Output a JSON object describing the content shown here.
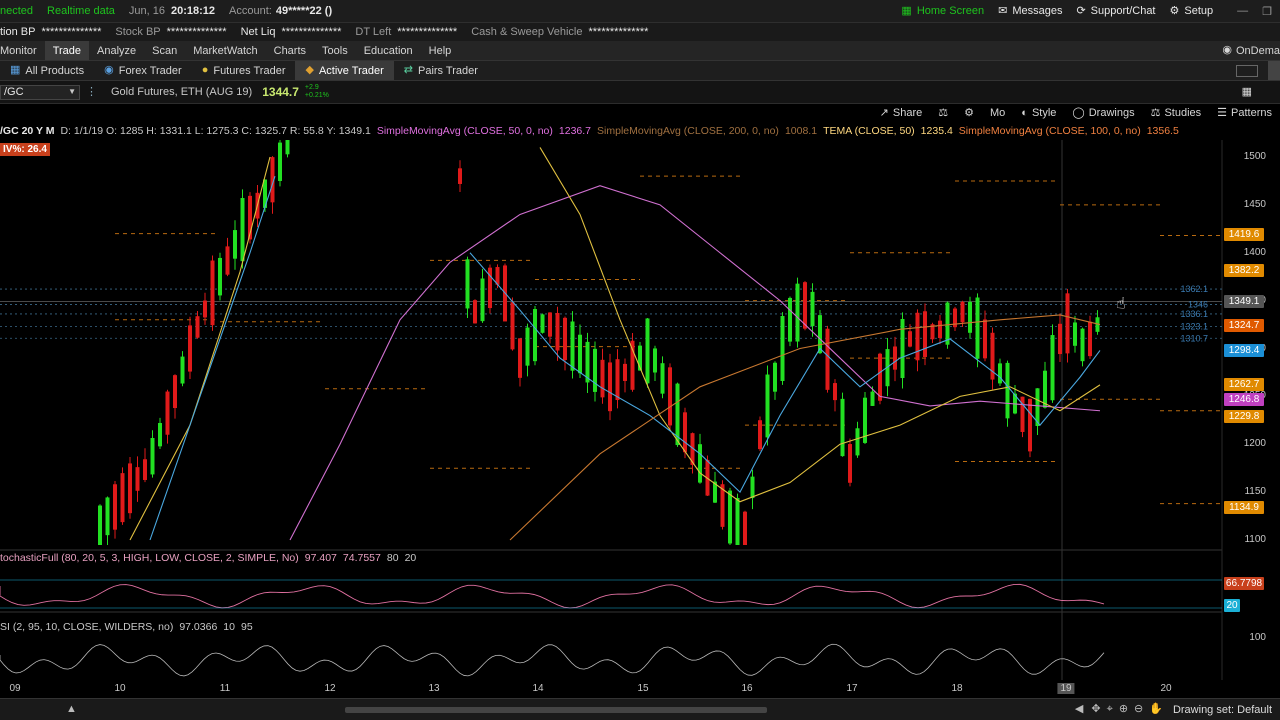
{
  "status": {
    "connection": "nected",
    "realtime": "Realtime data",
    "date": "Jun, 16",
    "time": "20:18:12",
    "account_label": "Account:",
    "account_value": "49*****22 ()",
    "home_screen": "Home Screen",
    "messages": "Messages",
    "support": "Support/Chat",
    "setup": "Setup"
  },
  "account_bar": {
    "option_bp_label": "tion BP",
    "option_bp_value": "**************",
    "stock_bp_label": "Stock BP",
    "stock_bp_value": "**************",
    "net_liq_label": "Net Liq",
    "net_liq_value": "**************",
    "dt_left_label": "DT Left",
    "dt_left_value": "**************",
    "cash_label": "Cash & Sweep Vehicle",
    "cash_value": "**************"
  },
  "menu": {
    "items": [
      "Monitor",
      "Trade",
      "Analyze",
      "Scan",
      "MarketWatch",
      "Charts",
      "Tools",
      "Education",
      "Help"
    ],
    "right": "OnDema"
  },
  "tabs": {
    "items": [
      "All Products",
      "Forex Trader",
      "Futures Trader",
      "Active Trader",
      "Pairs Trader"
    ]
  },
  "symbol": {
    "ticker": "/GC",
    "description": "Gold Futures, ETH (AUG 19)",
    "last": "1344.7",
    "change_top": "+2.9",
    "change_bottom": "+0.21%"
  },
  "chart_toolbar": {
    "share": "Share",
    "mode": "Mo",
    "style": "Style",
    "drawings": "Drawings",
    "studies": "Studies",
    "patterns": "Patterns"
  },
  "study_bar": {
    "period": "/GC 20 Y M",
    "ohlc": "D: 1/1/19   O: 1285   H: 1331.1   L: 1275.3   C: 1325.7   R: 55.8   Y: 1349.1",
    "sma50": "SimpleMovingAvg (CLOSE, 50, 0, no)",
    "sma50_value": "1236.7",
    "sma200": "SimpleMovingAvg (CLOSE, 200, 0, no)",
    "sma200_value": "1008.1",
    "tema": "TEMA (CLOSE, 50)",
    "tema_value": "1235.4",
    "sma100": "SimpleMovingAvg (CLOSE, 100, 0, no)",
    "sma100_value": "1356.5",
    "iv": "IV%: 26.4"
  },
  "chart_data": {
    "type": "candlestick",
    "x_ticks": [
      "09",
      "10",
      "11",
      "12",
      "13",
      "14",
      "15",
      "16",
      "17",
      "18",
      "19",
      "20"
    ],
    "y_ticks": [
      1500,
      1450,
      1400,
      1350,
      1300,
      1250,
      1200,
      1150,
      1100
    ],
    "ylim": [
      1090,
      1510
    ],
    "price_tags": [
      {
        "value": "1419.6",
        "color": "#e08a00"
      },
      {
        "value": "1382.2",
        "color": "#e08a00"
      },
      {
        "value": "1349.1",
        "color": "#555555"
      },
      {
        "value": "1324.7",
        "color": "#e05a00"
      },
      {
        "value": "1298.4",
        "color": "#1b8fd6"
      },
      {
        "value": "1262.7",
        "color": "#e08a00"
      },
      {
        "value": "1246.8",
        "color": "#c040c0"
      },
      {
        "value": "1229.8",
        "color": "#e08a00"
      },
      {
        "value": "1134.9",
        "color": "#e08a00"
      }
    ],
    "guide_labels": [
      "1362.1",
      "1346",
      "1336.1",
      "1323.1",
      "1310.7"
    ]
  },
  "stochastic": {
    "label": "tochasticFull (80, 20, 5, 3, HIGH, LOW, CLOSE, 2, SIMPLE, No)",
    "v1": "97.407",
    "v2": "74.7557",
    "v3": "80",
    "v4": "20",
    "tag_top": "66.7798",
    "tag_bottom": "20"
  },
  "rsi": {
    "label": "SI (2, 95, 10, CLOSE, WILDERS, no)",
    "v1": "97.0366",
    "v2": "10",
    "v3": "95",
    "axis": "100"
  },
  "bottom": {
    "drawing_set": "Drawing set: Default"
  }
}
